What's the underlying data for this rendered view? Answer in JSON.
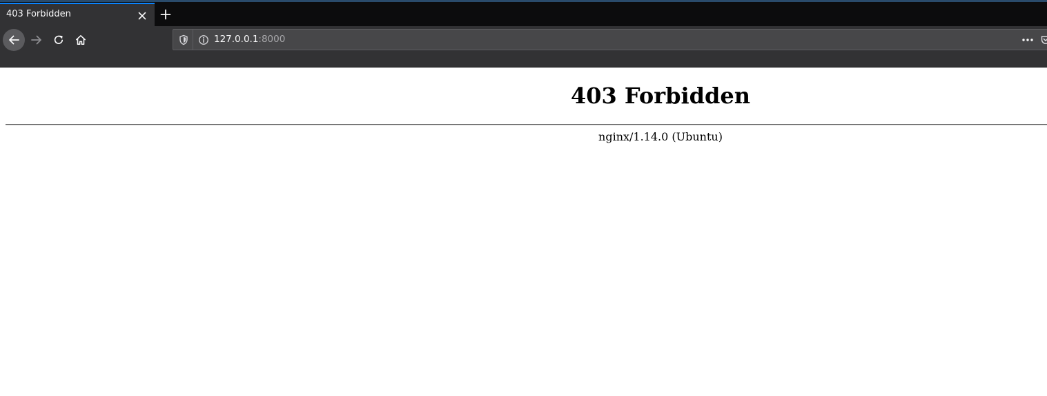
{
  "browser": {
    "tab": {
      "title": "403 Forbidden",
      "close_icon": "close-icon"
    },
    "new_tab_icon": "plus-icon",
    "nav": {
      "back_icon": "arrow-left-icon",
      "forward_icon": "arrow-right-icon",
      "reload_icon": "reload-icon",
      "home_icon": "home-icon"
    },
    "urlbar": {
      "host": "127.0.0.1",
      "port": ":8000",
      "tracking_icon": "shield-icon",
      "site_info_icon": "info-icon",
      "page_actions_icon": "more-icon",
      "pocket_icon": "pocket-icon"
    },
    "colors": {
      "tab_accent": "#0a84ff",
      "toolbar": "#323234",
      "tabstrip": "#0c0c0d"
    }
  },
  "page": {
    "heading": "403 Forbidden",
    "server": "nginx/1.14.0 (Ubuntu)"
  }
}
